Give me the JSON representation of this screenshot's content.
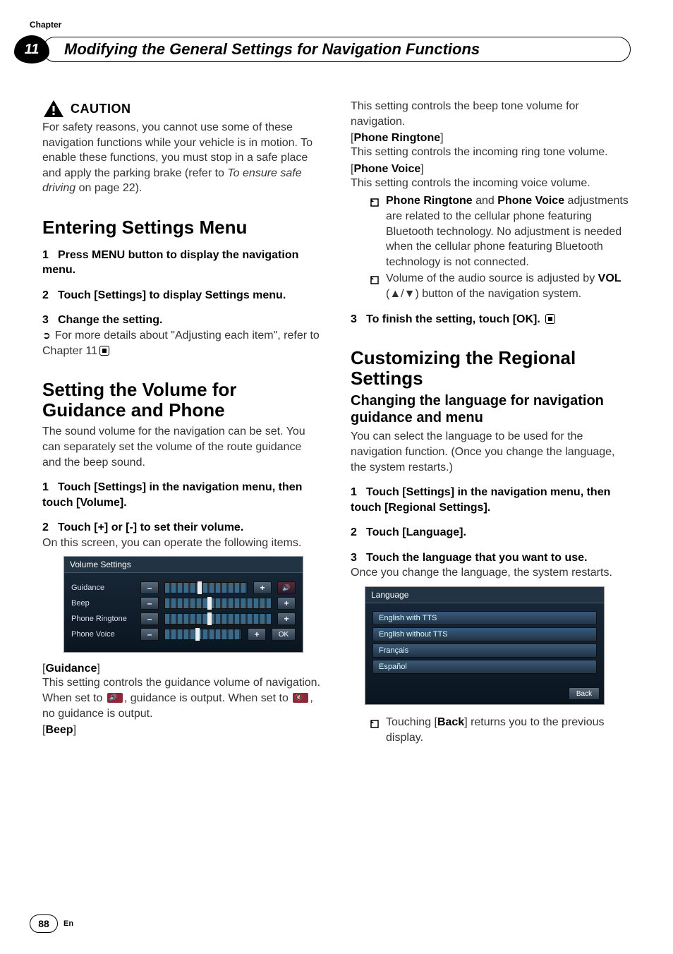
{
  "chapter": {
    "label": "Chapter",
    "number": "11"
  },
  "header": {
    "title": "Modifying the General Settings for Navigation Functions"
  },
  "caution": {
    "heading": "CAUTION",
    "body_a": "For safety reasons, you cannot use some of these navigation functions while your vehicle is in motion. To enable these functions, you must stop in a safe place and apply the parking brake (refer to ",
    "body_italic": "To ensure safe driving",
    "body_b": " on page 22)."
  },
  "s1": {
    "heading_a": "Entering ",
    "heading_mid": "Settings",
    "heading_b": " Menu",
    "step1": "Press MENU button to display the navigation menu.",
    "step2": "Touch [Settings] to display Settings menu.",
    "step3": "Change the setting.",
    "note_a": "For more details about \"Adjusting each item\", refer to Chapter 11"
  },
  "s2": {
    "heading": "Setting the Volume for Guidance and Phone",
    "intro": "The sound volume for the navigation can be set. You can separately set the volume of the route guidance and the beep sound.",
    "step1": "Touch [Settings] in the navigation menu, then touch [Volume].",
    "step2": "Touch [+] or [-] to set their volume.",
    "step2_body": "On this screen, you can operate the following items.",
    "screenshot": {
      "title": "Volume Settings",
      "rows": [
        "Guidance",
        "Beep",
        "Phone Ringtone",
        "Phone Voice"
      ],
      "minus": "–",
      "plus": "+",
      "ok": "OK"
    },
    "guidance_label": "Guidance",
    "guidance_body_a": "This setting controls the guidance volume of navigation.",
    "guidance_body_b1": "When set to ",
    "guidance_body_b2": ", guidance is output. When set to ",
    "guidance_body_b3": ", no guidance is output.",
    "beep_label": "Beep"
  },
  "right": {
    "beep_body": "This setting controls the beep tone volume for navigation.",
    "ringtone_label": "Phone Ringtone",
    "ringtone_body": "This setting controls the incoming ring tone volume.",
    "voice_label": "Phone Voice",
    "voice_body": "This setting controls the incoming voice volume.",
    "bullet1_a": "Phone Ringtone",
    "bullet1_mid": " and ",
    "bullet1_b": "Phone Voice",
    "bullet1_tail": " adjustments are related to the cellular phone featuring Bluetooth technology. No adjustment is needed when the cellular phone featuring Bluetooth technology is not connected.",
    "bullet2_a": "Volume of the audio source is adjusted by ",
    "bullet2_b": "VOL",
    "bullet2_c": " (▲/▼) button of the navigation system.",
    "step3": "To finish the setting, touch [OK]."
  },
  "s3": {
    "heading": "Customizing the Regional Settings",
    "sub": "Changing the language for navigation guidance and menu",
    "intro": "You can select the language to be used for the navigation function. (Once you change the language, the system restarts.)",
    "step1": "Touch [Settings] in the navigation menu, then touch [Regional Settings].",
    "step2": "Touch [Language].",
    "step3": "Touch the language that you want to use.",
    "step3_body": "Once you change the language, the system restarts.",
    "screenshot": {
      "title": "Language",
      "items": [
        "English with TTS",
        "English without TTS",
        "Français",
        "Español"
      ],
      "back": "Back"
    },
    "bullet_a": "Touching [",
    "bullet_b": "Back",
    "bullet_c": "] returns you to the previous display."
  },
  "footer": {
    "page": "88",
    "lang": "En"
  },
  "nums": {
    "n1": "1",
    "n2": "2",
    "n3": "3"
  }
}
